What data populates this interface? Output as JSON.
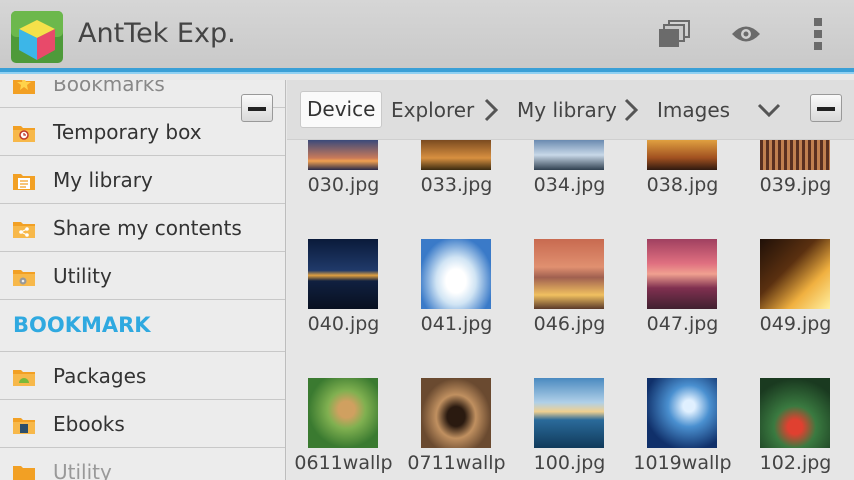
{
  "app": {
    "title": "AntTek Exp."
  },
  "actionbar": {
    "icons": [
      "windows-icon",
      "eye-icon",
      "overflow-menu-icon"
    ]
  },
  "sidebar": {
    "items_top": [
      {
        "label": "Bookmarks",
        "icon": "star-folder-icon"
      },
      {
        "label": "Temporary box",
        "icon": "clock-folder-icon"
      },
      {
        "label": "My library",
        "icon": "library-folder-icon"
      },
      {
        "label": "Share my contents",
        "icon": "share-folder-icon"
      },
      {
        "label": "Utility",
        "icon": "gear-folder-icon"
      }
    ],
    "section_header": "BOOKMARK",
    "items_bottom": [
      {
        "label": "Packages",
        "icon": "android-folder-icon"
      },
      {
        "label": "Ebooks",
        "icon": "book-folder-icon"
      },
      {
        "label": "Utility",
        "icon": "folder-icon"
      }
    ]
  },
  "breadcrumb": {
    "device": "Device",
    "items": [
      "Explorer",
      "My library",
      "Images"
    ]
  },
  "files": [
    "030.jpg",
    "033.jpg",
    "034.jpg",
    "038.jpg",
    "039.jpg",
    "040.jpg",
    "041.jpg",
    "046.jpg",
    "047.jpg",
    "049.jpg",
    "0611wallp",
    "0711wallp",
    "100.jpg",
    "1019wallp",
    "102.jpg"
  ],
  "colors": {
    "accent": "#3a9fd6",
    "section": "#2fa9e0"
  }
}
